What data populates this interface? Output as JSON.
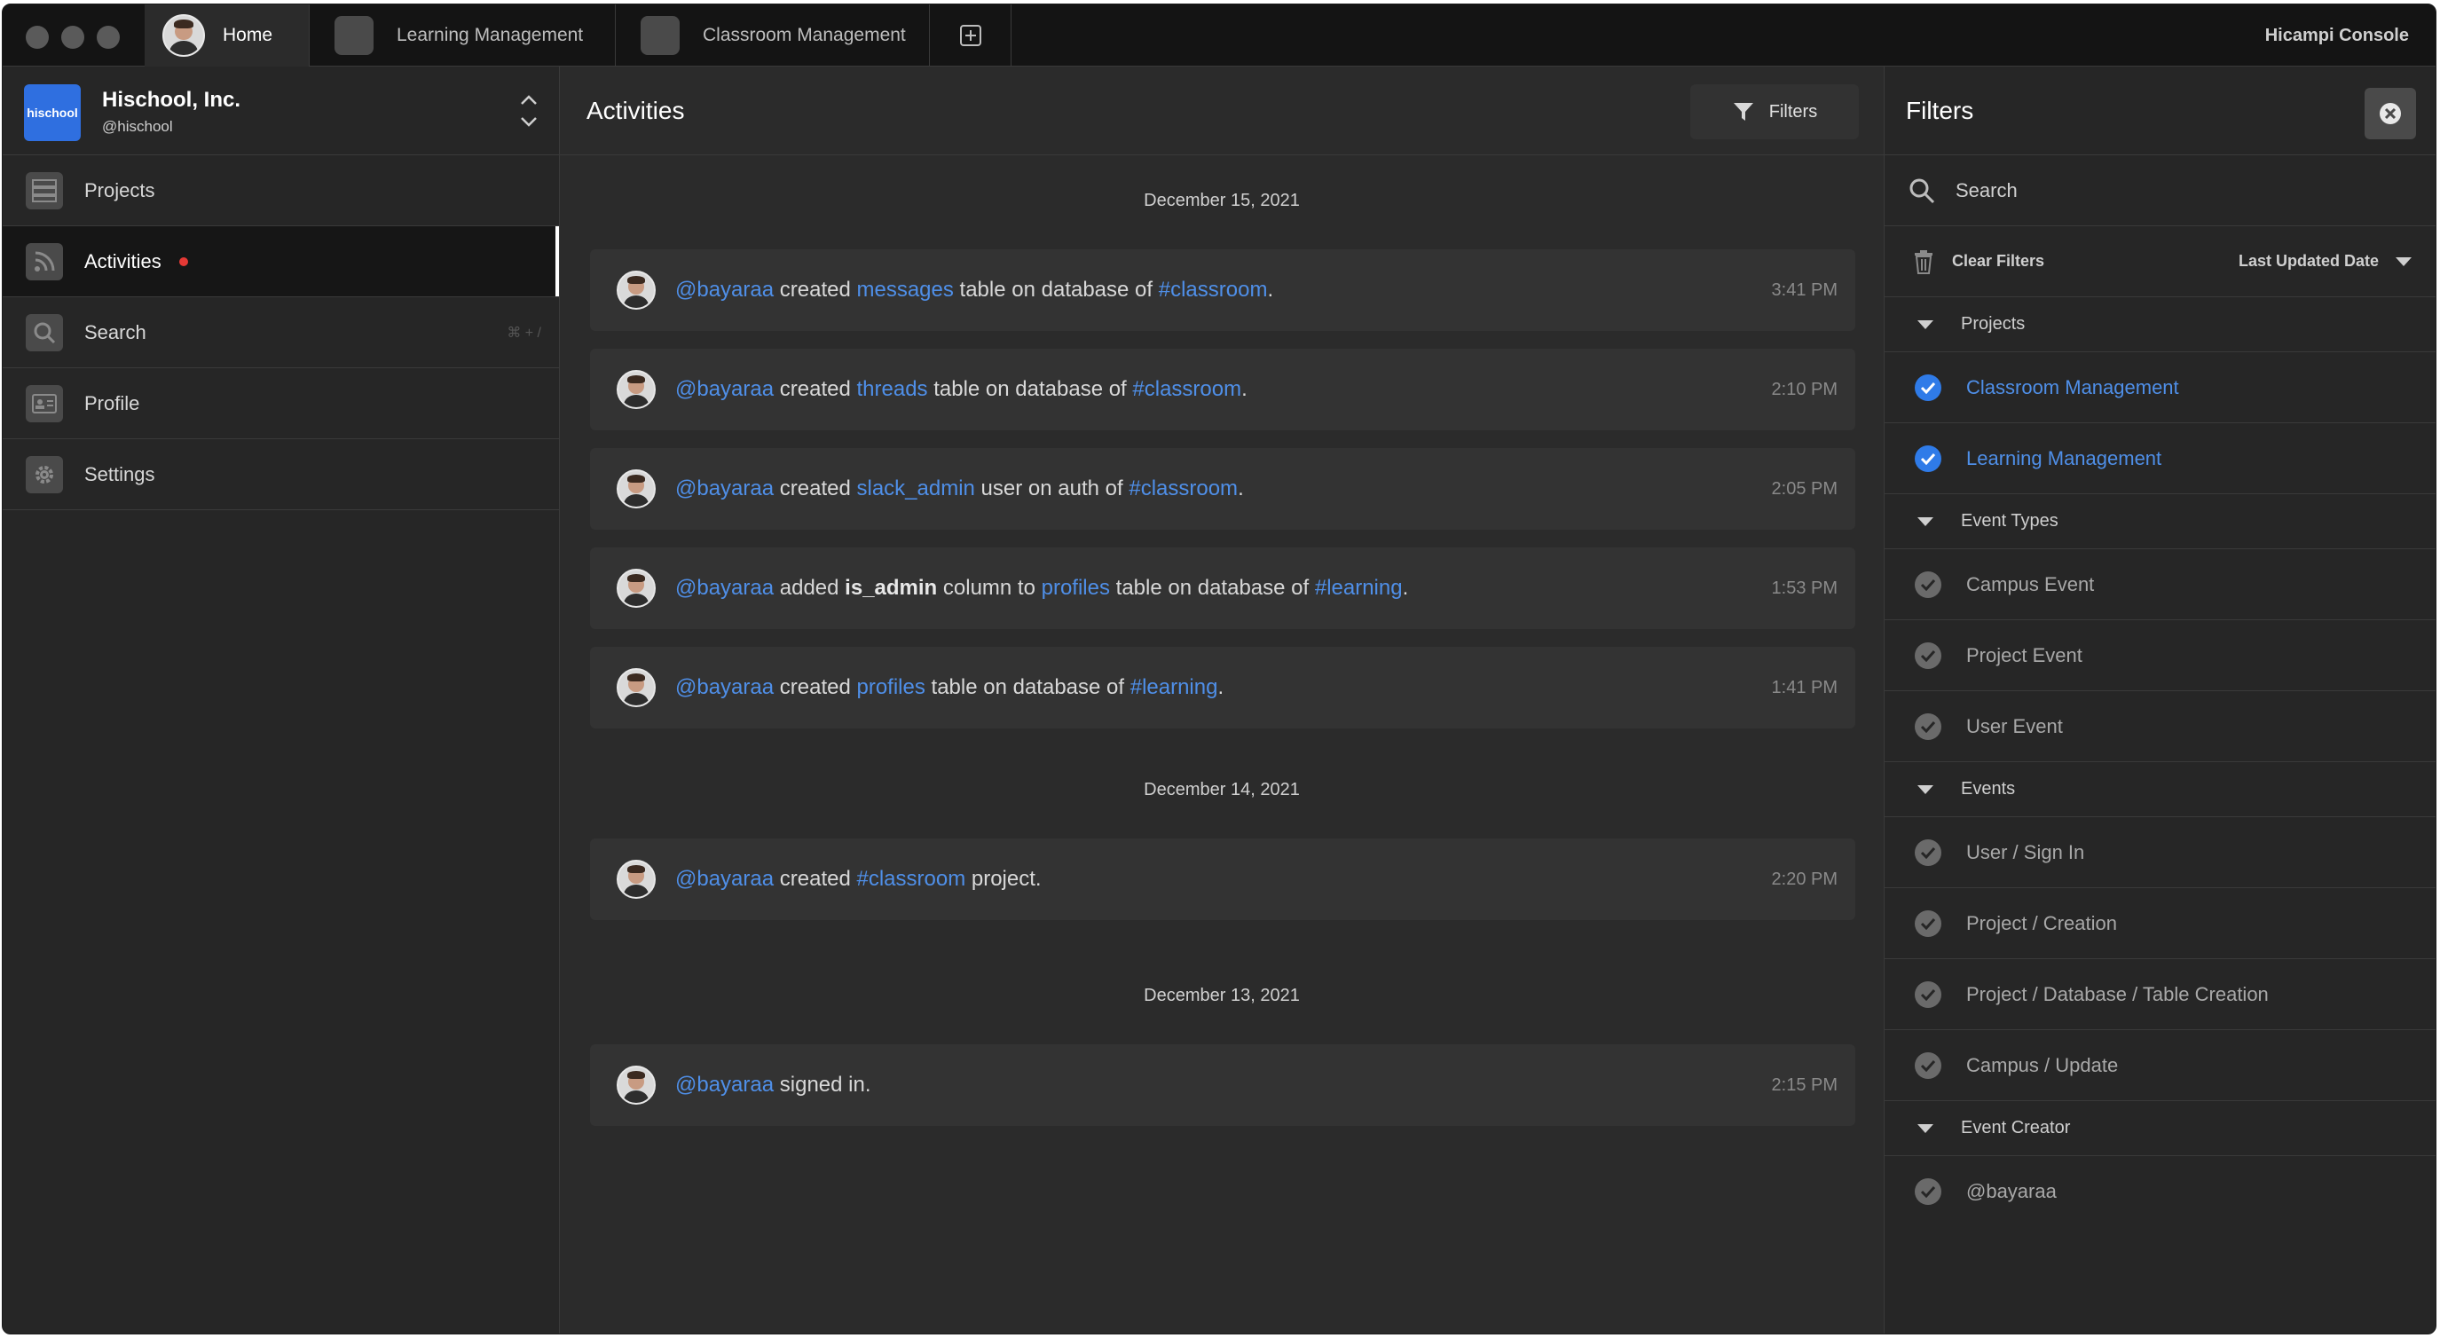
{
  "tabs": [
    {
      "label": "Home"
    },
    {
      "label": "Learning Management"
    },
    {
      "label": "Classroom Management"
    }
  ],
  "console_title": "Hicampi Console",
  "org": {
    "logo_text": "hischool",
    "name": "Hischool, Inc.",
    "handle": "@hischool"
  },
  "sidebar": {
    "items": [
      {
        "label": "Projects",
        "icon": "server-icon"
      },
      {
        "label": "Activities",
        "icon": "rss-icon",
        "unread": true
      },
      {
        "label": "Search",
        "icon": "search-icon",
        "shortcut": "⌘ + /"
      },
      {
        "label": "Profile",
        "icon": "id-card-icon"
      },
      {
        "label": "Settings",
        "icon": "gear-icon"
      }
    ]
  },
  "main": {
    "title": "Activities",
    "filters_button": "Filters",
    "groups": [
      {
        "date": "December 15, 2021",
        "items": [
          {
            "user": "@bayaraa",
            "p1": " created ",
            "l1": "messages",
            "p2": " table on database of ",
            "l2": "#classroom",
            "p3": ".",
            "time": "3:41 PM"
          },
          {
            "user": "@bayaraa",
            "p1": " created ",
            "l1": "threads",
            "p2": " table on database of ",
            "l2": "#classroom",
            "p3": ".",
            "time": "2:10 PM"
          },
          {
            "user": "@bayaraa",
            "p1": " created ",
            "l1": "slack_admin",
            "p2": " user on auth of ",
            "l2": "#classroom",
            "p3": ".",
            "time": "2:05 PM"
          },
          {
            "user": "@bayaraa",
            "p1": " added ",
            "bold": "is_admin",
            "p1b": " column to ",
            "l1": "profiles",
            "p2": " table on database of ",
            "l2": "#learning",
            "p3": ".",
            "time": "1:53 PM"
          },
          {
            "user": "@bayaraa",
            "p1": " created ",
            "l1": "profiles",
            "p2": " table on database of ",
            "l2": "#learning",
            "p3": ".",
            "time": "1:41 PM"
          }
        ]
      },
      {
        "date": "December 14, 2021",
        "items": [
          {
            "user": "@bayaraa",
            "p1": " created ",
            "l1": "#classroom",
            "p2": " project.",
            "time": "2:20 PM"
          }
        ]
      },
      {
        "date": "December 13, 2021",
        "items": [
          {
            "user": "@bayaraa",
            "p1": " signed in.",
            "time": "2:15 PM"
          }
        ]
      }
    ]
  },
  "filters": {
    "title": "Filters",
    "search_placeholder": "Search",
    "clear_label": "Clear Filters",
    "sort_label": "Last Updated Date",
    "sections": [
      {
        "label": "Projects",
        "options": [
          {
            "label": "Classroom Management",
            "checked": true
          },
          {
            "label": "Learning Management",
            "checked": true
          }
        ]
      },
      {
        "label": "Event Types",
        "options": [
          {
            "label": "Campus Event",
            "checked": false
          },
          {
            "label": "Project Event",
            "checked": false
          },
          {
            "label": "User Event",
            "checked": false
          }
        ]
      },
      {
        "label": "Events",
        "options": [
          {
            "label": "User / Sign In",
            "checked": false
          },
          {
            "label": "Project / Creation",
            "checked": false
          },
          {
            "label": "Project / Database / Table Creation",
            "checked": false
          },
          {
            "label": "Campus / Update",
            "checked": false
          }
        ]
      },
      {
        "label": "Event Creator",
        "options": [
          {
            "label": "@bayaraa",
            "checked": false
          }
        ]
      }
    ]
  },
  "colors": {
    "link": "#4f8fe8",
    "checked": "#2f7be8",
    "unread_dot": "#e53935",
    "logo": "#2f6fe0"
  }
}
